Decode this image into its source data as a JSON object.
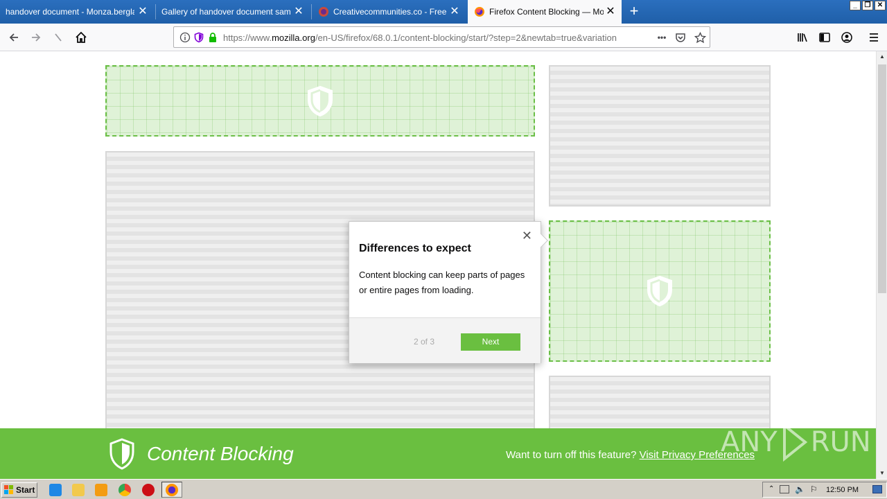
{
  "tabs": [
    {
      "title": "handover document - Monza.berglauf-",
      "active": false
    },
    {
      "title": "Gallery of handover document sample",
      "active": false
    },
    {
      "title": "Creativecommunities.co - Free All",
      "active": false
    },
    {
      "title": "Firefox Content Blocking — Mozilla",
      "active": true
    }
  ],
  "tab_close_glyph": "✕",
  "new_tab_glyph": "+",
  "window_controls": {
    "minimize": "_",
    "restore": "❐",
    "close": "✕"
  },
  "url": {
    "prefix": "https://www.",
    "domain": "mozilla.org",
    "path": "/en-US/firefox/68.0.1/content-blocking/start/?step=2&newtab=true&variation"
  },
  "url_actions": {
    "more": "•••"
  },
  "popup": {
    "title": "Differences to expect",
    "body": "Content blocking can keep parts of pages or entire pages from loading.",
    "close_glyph": "✕",
    "step": "2 of 3",
    "next_label": "Next"
  },
  "banner": {
    "title": "Content Blocking",
    "question": "Want to turn off this feature?",
    "link": "Visit Privacy Preferences"
  },
  "watermark": {
    "text1": "ANY",
    "text2": "RUN"
  },
  "taskbar": {
    "start_label": "Start",
    "clock": "12:50 PM"
  },
  "colors": {
    "accent_green": "#6abf40",
    "tab_strip_blue": "#1f5fa8",
    "blocked_fill": "#dff2d7"
  }
}
